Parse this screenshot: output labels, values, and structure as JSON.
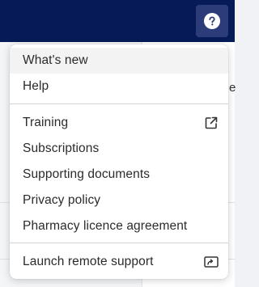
{
  "header": {
    "help_icon": "question-circle-icon"
  },
  "background": {
    "peek_text": "e"
  },
  "help_menu": {
    "group1": [
      {
        "label": "What's new",
        "highlighted": true
      },
      {
        "label": "Help"
      }
    ],
    "group2": [
      {
        "label": "Training",
        "trailing_icon": "open-in-new-icon"
      },
      {
        "label": "Subscriptions"
      },
      {
        "label": "Supporting documents"
      },
      {
        "label": "Privacy policy"
      },
      {
        "label": "Pharmacy licence agreement"
      }
    ],
    "group3": [
      {
        "label": "Launch remote support",
        "trailing_icon": "screen-share-icon"
      }
    ]
  },
  "colors": {
    "topbar": "#051a57",
    "help_button": "#2c3c78",
    "menu_bg": "#ffffff",
    "hover": "#f3f3f4"
  }
}
